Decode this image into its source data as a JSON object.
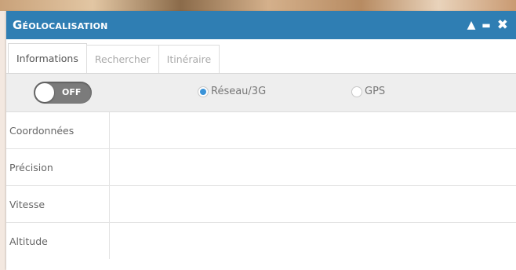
{
  "window": {
    "title": "Géolocalisation",
    "controls": {
      "collapse_glyph": "▲",
      "minimize_glyph": "▬",
      "close_glyph": "✖"
    }
  },
  "tabs": [
    {
      "label": "Informations",
      "active": true
    },
    {
      "label": "Rechercher",
      "active": false
    },
    {
      "label": "Itinéraire",
      "active": false
    }
  ],
  "toolbar": {
    "toggle": {
      "label": "OFF",
      "on": false
    },
    "radios": [
      {
        "label": "Réseau/3G",
        "selected": true
      },
      {
        "label": "GPS",
        "selected": false
      }
    ]
  },
  "info_rows": [
    {
      "label": "Coordonnées",
      "value": ""
    },
    {
      "label": "Précision",
      "value": ""
    },
    {
      "label": "Vitesse",
      "value": ""
    },
    {
      "label": "Altitude",
      "value": ""
    }
  ],
  "colors": {
    "titlebar": "#2f7eb3",
    "toggle_off": "#7b7b7b",
    "radio_selected": "#3a93d8",
    "toolbar_bg": "#eeeeee"
  }
}
